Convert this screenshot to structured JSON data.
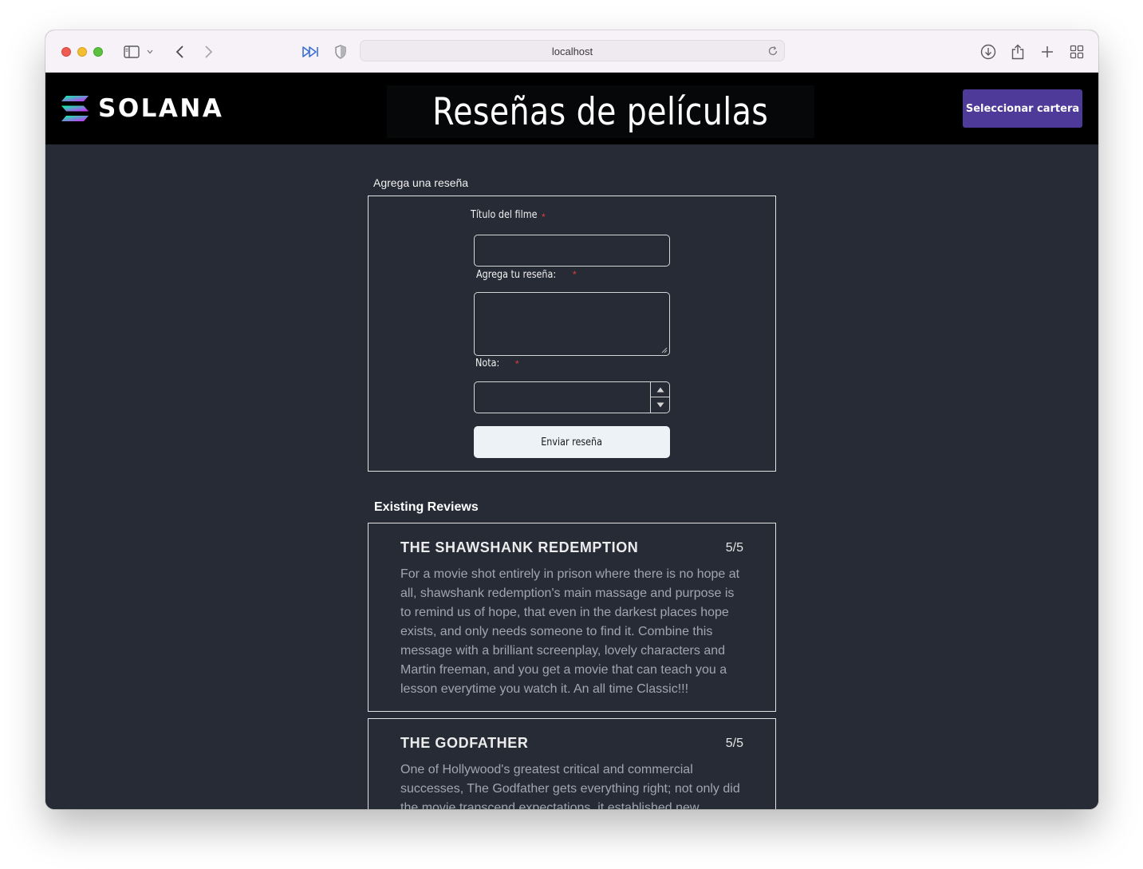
{
  "browser": {
    "url": "localhost"
  },
  "navbar": {
    "logo_text": "SOLANA",
    "title": "Reseñas de películas",
    "wallet_button": "Seleccionar cartera"
  },
  "form": {
    "heading": "Agrega una reseña",
    "title_label": "Título del filme",
    "review_label": "Agrega tu reseña:",
    "rating_label": "Nota:",
    "required_marker": "*",
    "title_value": "",
    "review_value": "",
    "rating_value": "",
    "submit_label": "Enviar reseña"
  },
  "reviews": {
    "heading": "Existing Reviews",
    "items": [
      {
        "title": "THE SHAWSHANK REDEMPTION",
        "score": "5/5",
        "text": "For a movie shot entirely in prison where there is no hope at all, shawshank redemption's main massage and purpose is to remind us of hope, that even in the darkest places hope exists, and only needs someone to find it. Combine this message with a brilliant screenplay, lovely characters and Martin freeman, and you get a movie that can teach you a lesson everytime you watch it. An all time Classic!!!"
      },
      {
        "title": "THE GODFATHER",
        "score": "5/5",
        "text": "One of Hollywood's greatest critical and commercial successes, The Godfather gets everything right; not only did the movie transcend expectations, it established new"
      }
    ]
  },
  "colors": {
    "page_background": "#272b36",
    "navbar_background": "#000000",
    "wallet_button": "#4d3a99",
    "required_marker": "#e53e3e"
  }
}
